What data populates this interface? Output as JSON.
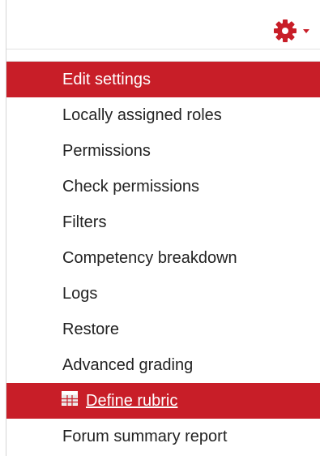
{
  "colors": {
    "accent": "#c81e28",
    "text": "#222222",
    "active_text": "#ffffff"
  },
  "topbar": {
    "actions_icon": "gear-icon",
    "caret_icon": "caret-down-icon"
  },
  "menu": {
    "items": [
      {
        "label": "Edit settings"
      },
      {
        "label": "Locally assigned roles"
      },
      {
        "label": "Permissions"
      },
      {
        "label": "Check permissions"
      },
      {
        "label": "Filters"
      },
      {
        "label": "Competency breakdown"
      },
      {
        "label": "Logs"
      },
      {
        "label": "Restore"
      },
      {
        "label": "Advanced grading"
      },
      {
        "label": "Define rubric",
        "icon": "rubric-grid-icon"
      },
      {
        "label": "Forum summary report"
      }
    ]
  }
}
